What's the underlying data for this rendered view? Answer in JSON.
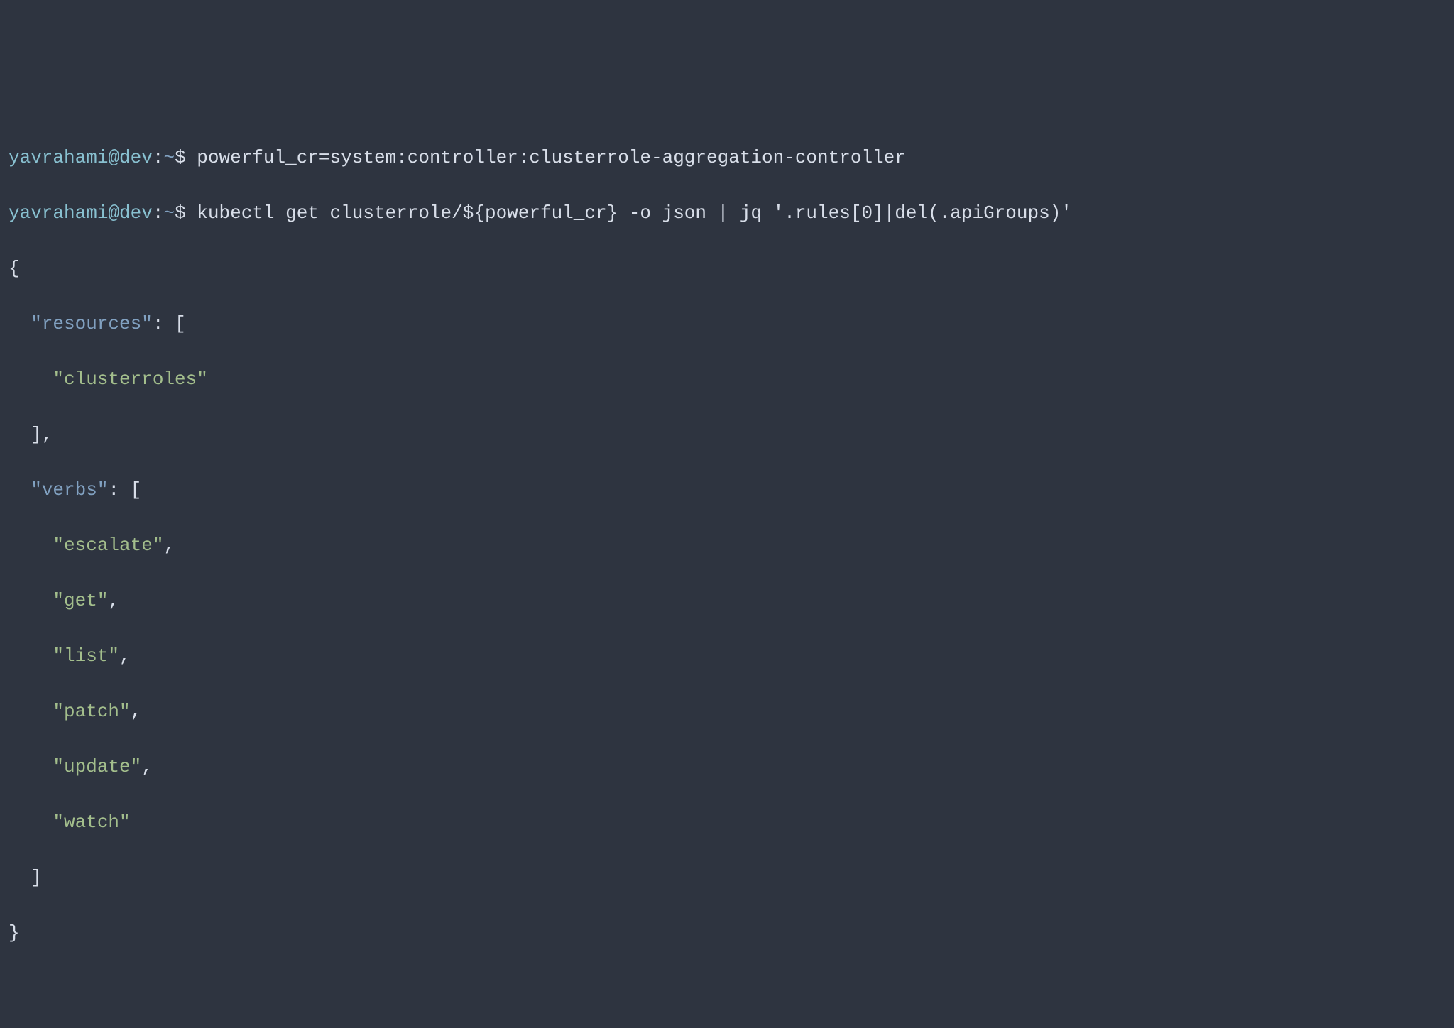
{
  "prompt": {
    "user": "yavrahami",
    "at": "@",
    "host": "dev",
    "colon": ":",
    "path": "~",
    "dollar": "$"
  },
  "commands": {
    "line1": "powerful_cr=system:controller:clusterrole-aggregation-controller",
    "line2": "kubectl get clusterrole/${powerful_cr} -o json | jq '.rules[0]|del(.apiGroups)'"
  },
  "output": {
    "open_brace": "{",
    "resources_key": "\"resources\"",
    "colon_bracket": ": [",
    "clusterroles": "\"clusterroles\"",
    "close_bracket_comma": "],",
    "verbs_key": "\"verbs\"",
    "escalate": "\"escalate\"",
    "get": "\"get\"",
    "list": "\"list\"",
    "patch": "\"patch\"",
    "update": "\"update\"",
    "watch": "\"watch\"",
    "comma": ",",
    "close_bracket": "]",
    "close_brace": "}"
  }
}
